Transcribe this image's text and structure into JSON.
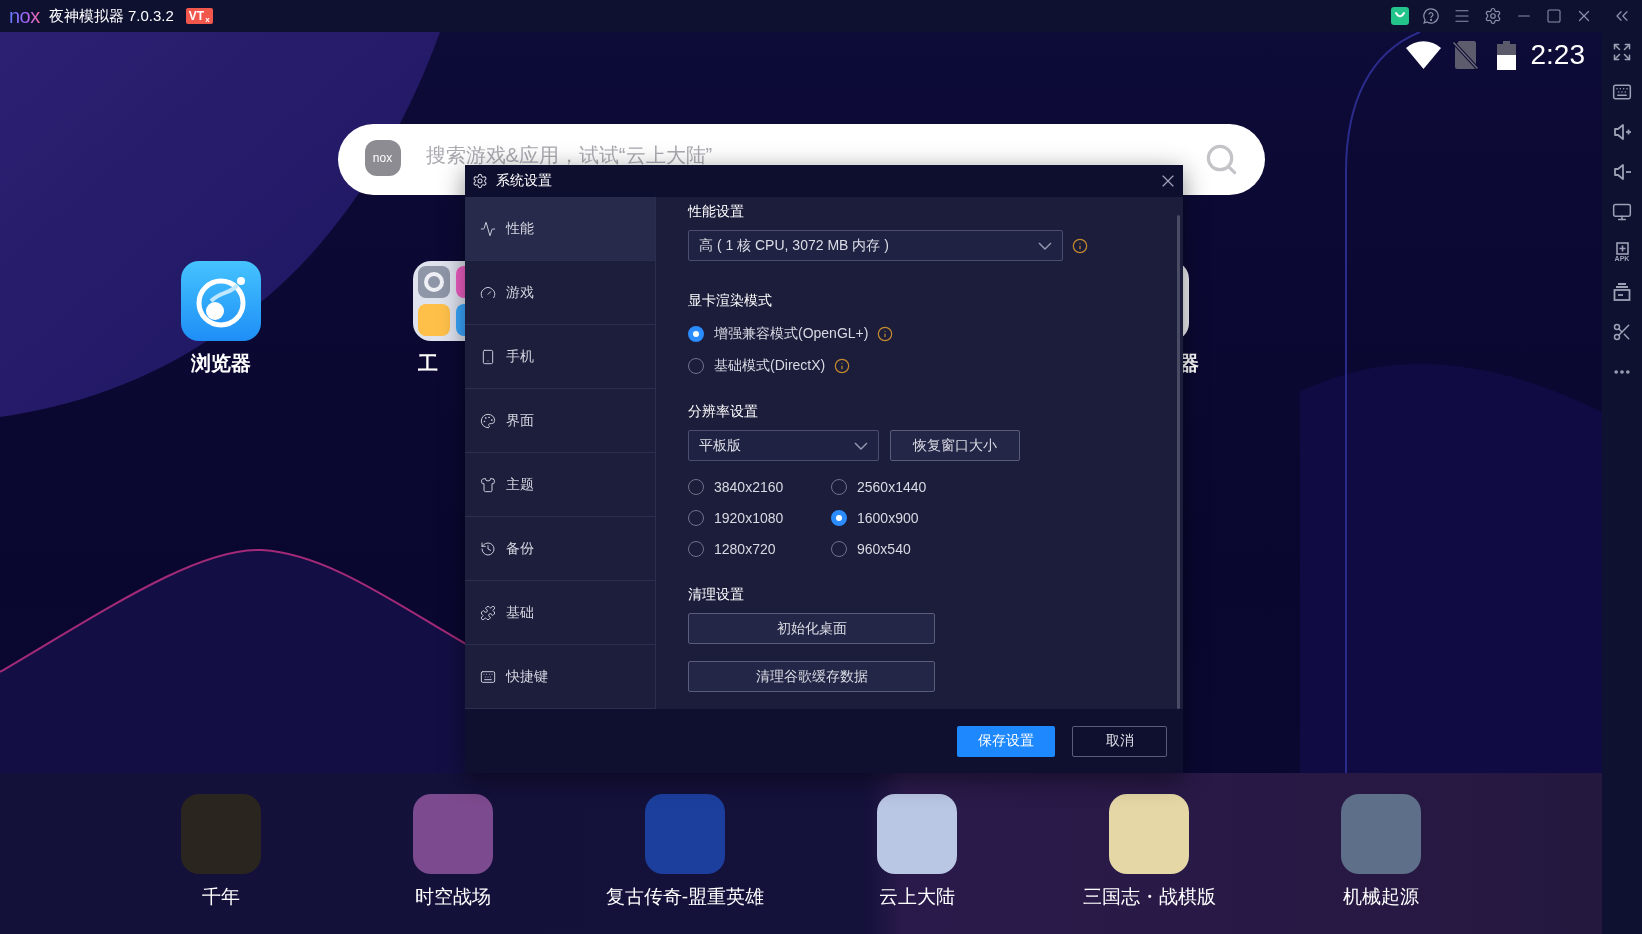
{
  "titlebar": {
    "logo": "nox",
    "title": "夜神模拟器 7.0.3.2",
    "badge": "VT$_{x}$"
  },
  "sidebar": {
    "apk_label": "APK"
  },
  "status_bar": {
    "time": "2:23"
  },
  "search": {
    "logo": "nox",
    "placeholder": "搜索游戏&应用，试试“云上大陆”"
  },
  "home_apps": [
    {
      "label": "浏览器"
    },
    {
      "label": "工"
    },
    {
      "label": "器"
    }
  ],
  "dock_apps": [
    {
      "label": "千年"
    },
    {
      "label": "时空战场"
    },
    {
      "label": "复古传奇-盟重英雄"
    },
    {
      "label": "云上大陆"
    },
    {
      "label": "三国志・战棋版"
    },
    {
      "label": "机械起源"
    }
  ],
  "dialog": {
    "title": "系统设置",
    "nav": [
      {
        "label": "性能",
        "selected": true
      },
      {
        "label": "游戏",
        "selected": false
      },
      {
        "label": "手机",
        "selected": false
      },
      {
        "label": "界面",
        "selected": false
      },
      {
        "label": "主题",
        "selected": false
      },
      {
        "label": "备份",
        "selected": false
      },
      {
        "label": "基础",
        "selected": false
      },
      {
        "label": "快捷键",
        "selected": false
      }
    ],
    "performance": {
      "heading": "性能设置",
      "select": {
        "value": "高 ( 1 核 CPU, 3072 MB 内存 )",
        "info": true
      }
    },
    "render_mode": {
      "heading": "显卡渲染模式",
      "options": [
        {
          "label": "增强兼容模式(OpenGL+)",
          "selected": true,
          "info": true
        },
        {
          "label": "基础模式(DirectX)",
          "selected": false,
          "info": true
        }
      ]
    },
    "resolution": {
      "heading": "分辨率设置",
      "select": {
        "value": "平板版"
      },
      "button": "恢复窗口大小",
      "options": [
        {
          "label": "3840x2160",
          "selected": false
        },
        {
          "label": "2560x1440",
          "selected": false
        },
        {
          "label": "1920x1080",
          "selected": false
        },
        {
          "label": "1600x900",
          "selected": true
        },
        {
          "label": "1280x720",
          "selected": false
        },
        {
          "label": "960x540",
          "selected": false
        }
      ]
    },
    "cleanup": {
      "heading": "清理设置",
      "buttons": [
        "初始化桌面",
        "清理谷歌缓存数据"
      ]
    },
    "buttons": [
      {
        "label": "保存设置",
        "kind": "primary"
      },
      {
        "label": "取消",
        "kind": "secondary"
      }
    ]
  }
}
